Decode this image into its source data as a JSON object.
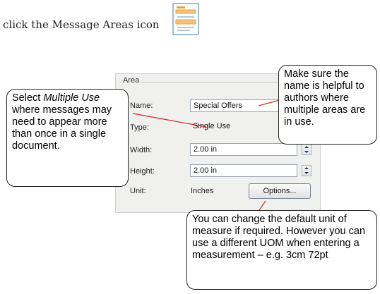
{
  "instruction": "click the Message Areas icon",
  "icon": {
    "name": "message-areas-icon",
    "accent": "#e7a23c",
    "frame": "#5a8fc9"
  },
  "dialog": {
    "group_title": "Area",
    "fields": {
      "name_label": "Name:",
      "name_value": "Special Offers",
      "type_label": "Type:",
      "type_value": "Single Use",
      "width_label": "Width:",
      "width_value": "2.00 in",
      "height_label": "Height:",
      "height_value": "2.00 in",
      "unit_label": "Unit:",
      "unit_value": "Inches"
    },
    "options_button": "Options..."
  },
  "callouts": {
    "multiple_use_prefix": "Select ",
    "multiple_use_em": "Multiple Use",
    "multiple_use_rest": "where messages may need to appear more than once in a single document.",
    "name_hint": "Make sure the name is helpful to authors where multiple areas are in use.",
    "unit_hint": "You can change the default unit of measure if required. However you can use a different UOM when entering a measurement – e.g. 3cm 72pt"
  },
  "colors": {
    "pointer_red": "#e0201b",
    "pointer_line": "#c43a1a"
  }
}
